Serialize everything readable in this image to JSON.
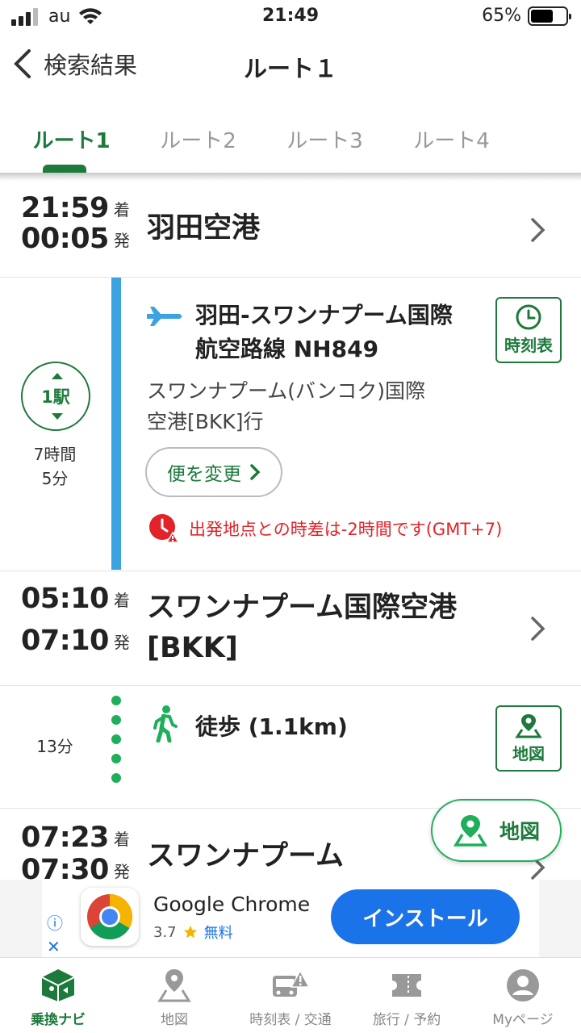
{
  "status_bar": {
    "carrier": "au",
    "time": "21:49",
    "battery": "65%",
    "battery_level": 0.65
  },
  "nav": {
    "back_label": "検索結果",
    "title": "ルート１"
  },
  "tabs": [
    {
      "label": "ルート1",
      "active": true
    },
    {
      "label": "ルート2",
      "active": false
    },
    {
      "label": "ルート3",
      "active": false
    },
    {
      "label": "ルート4",
      "active": false
    }
  ],
  "route": {
    "origin": {
      "arrive": "21:59",
      "arrive_label": "着",
      "depart": "00:05",
      "depart_label": "発",
      "name": "羽田空港"
    },
    "flight": {
      "stops": "1駅",
      "duration_line1": "7時間",
      "duration_line2": "5分",
      "line_name_1": "羽田-スワンナプーム国際",
      "line_name_2": "航空路線 NH849",
      "dest_1": "スワンナプーム(バンコク)国際",
      "dest_2": "空港[BKK]行",
      "change_label": "便を変更",
      "warning": "出発地点との時差は-2時間です(GMT+7)",
      "timetable_label": "時刻表",
      "line_color": "#3ba4e0"
    },
    "transfer": {
      "arrive": "05:10",
      "arrive_label": "着",
      "depart": "07:10",
      "depart_label": "発",
      "name_1": "スワンナプーム国際空港",
      "name_2": "[BKK]"
    },
    "walk": {
      "duration": "13分",
      "label": "徒歩 (1.1km)",
      "map_label": "地図",
      "dot_color": "#1faf5a"
    },
    "next": {
      "arrive": "07:23",
      "arrive_label": "着",
      "depart": "07:30",
      "depart_label": "発",
      "name": "スワンナプーム"
    }
  },
  "map_fab": {
    "label": "地図"
  },
  "ad": {
    "app_name": "Google Chrome",
    "rating": "3.7",
    "price": "無料",
    "install_label": "インストール",
    "info_icon": "ⓘ",
    "close_icon": "✕"
  },
  "bottom_nav": [
    {
      "label": "乗換ナビ",
      "icon": "transit-nav-icon",
      "active": true
    },
    {
      "label": "地図",
      "icon": "map-pin-icon",
      "active": false
    },
    {
      "label": "時刻表 / 交通",
      "icon": "bus-alert-icon",
      "active": false
    },
    {
      "label": "旅行 / 予約",
      "icon": "ticket-icon",
      "active": false
    },
    {
      "label": "Myページ",
      "icon": "user-icon",
      "active": false
    }
  ],
  "colors": {
    "accent": "#1e7a3c",
    "flight_line": "#3ba4e0",
    "warning": "#e0242a",
    "install": "#1a73e8"
  }
}
